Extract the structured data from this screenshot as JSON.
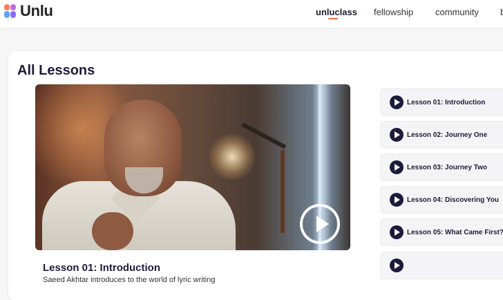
{
  "brand": {
    "name": "Unlu"
  },
  "nav": [
    {
      "label": "unluclass",
      "active": true
    },
    {
      "label": "fellowship",
      "active": false
    },
    {
      "label": "community",
      "active": false
    },
    {
      "label": "b",
      "active": false
    }
  ],
  "page": {
    "title": "All Lessons"
  },
  "video": {
    "icon": "play-icon"
  },
  "current_lesson": {
    "title": "Lesson 01: Introduction",
    "description": "Saeed Akhtar introduces to the world of lyric writing"
  },
  "lessons": [
    {
      "label": "Lesson 01: Introduction"
    },
    {
      "label": "Lesson 02: Journey One"
    },
    {
      "label": "Lesson 03: Journey Two"
    },
    {
      "label": "Lesson 04: Discovering You"
    },
    {
      "label": "Lesson 05: What Came First?"
    },
    {
      "label": ""
    }
  ],
  "colors": {
    "accent": "#ff6b4a",
    "primary": "#1e1b3a"
  }
}
